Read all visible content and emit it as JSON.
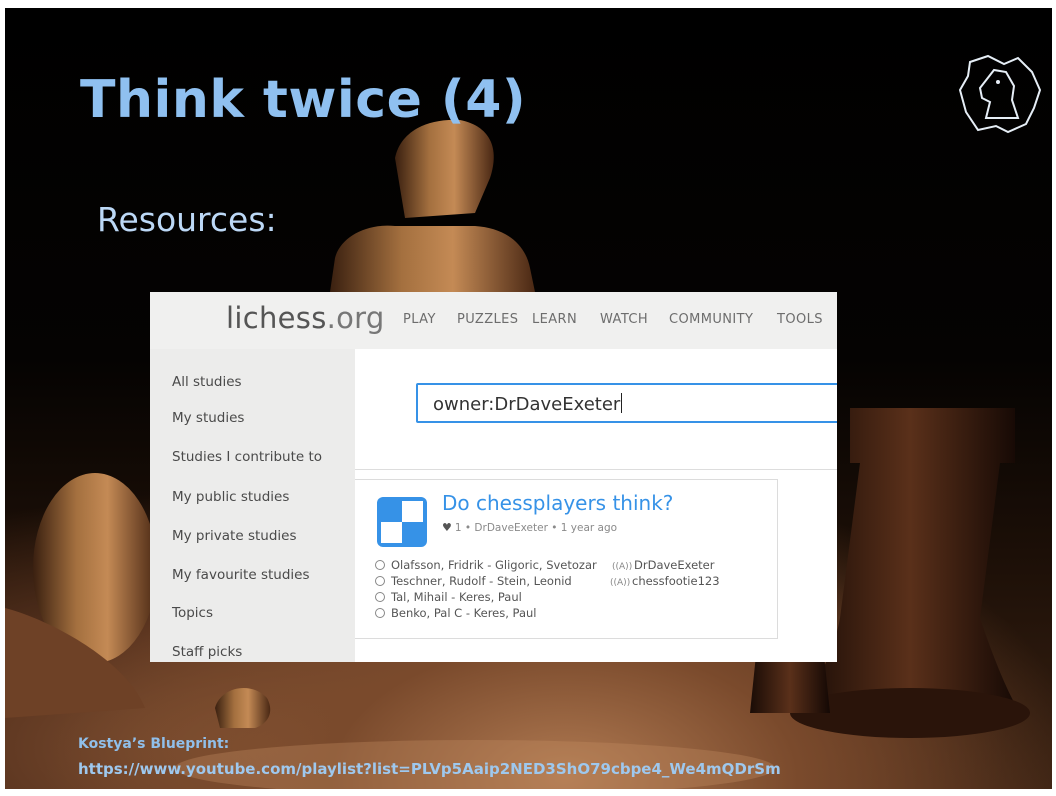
{
  "slide": {
    "title": "Think twice (4)",
    "subtitle": "Resources:",
    "footer_label": "Kostya’s Blueprint:",
    "footer_url": "https://www.youtube.com/playlist?list=PLVp5Aaip2NED3ShO79cbpe4_We4mQDrSm"
  },
  "lichess": {
    "logo_main": "lichess",
    "logo_tld": ".org",
    "nav": [
      "PLAY",
      "PUZZLES",
      "LEARN",
      "WATCH",
      "COMMUNITY",
      "TOOLS"
    ],
    "sidebar": [
      "All studies",
      "My studies",
      "Studies I contribute to",
      "My public studies",
      "My private studies",
      "My favourite studies",
      "Topics",
      "Staff picks"
    ],
    "search_value": "owner:DrDaveExeter",
    "study": {
      "title": "Do chessplayers think?",
      "likes": "1",
      "meta": "• DrDaveExeter • 1 year ago",
      "chapters": [
        "Olafsson, Fridrik - Gligoric, Svetozar",
        "Teschner, Rudolf - Stein, Leonid",
        "Tal, Mihail - Keres, Paul",
        "Benko, Pal C - Keres, Paul"
      ],
      "members": [
        "DrDaveExeter",
        "chessfootie123"
      ]
    }
  },
  "colors": {
    "title": "#8fc0f0",
    "subtitle": "#bcd8f6",
    "link_blue": "#3692e7",
    "footer": "#90bfea"
  },
  "icons": [
    "knight-logo-icon",
    "study-board-icon",
    "heart-icon",
    "chapter-circle-icon",
    "broadcast-member-icon"
  ]
}
